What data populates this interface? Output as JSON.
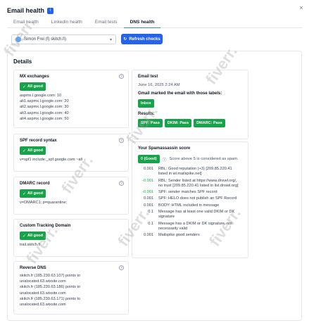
{
  "header": {
    "title": "Email health",
    "close_label": "×"
  },
  "tabs": [
    {
      "label": "Email health",
      "active": false
    },
    {
      "label": "LinkedIn health",
      "active": false
    },
    {
      "label": "Email tests",
      "active": false
    },
    {
      "label": "DNS health",
      "active": true
    }
  ],
  "account_select": {
    "value": "Simon Frei (f) skitch.fi)",
    "chevron": "chevron-down-icon"
  },
  "refresh_button": {
    "label": "Refresh checks",
    "icon": "refresh-icon"
  },
  "details_title": "Details",
  "left": {
    "mx": {
      "title": "MX exchanges",
      "status": "All good",
      "lines": [
        "aspmx.l.google.com: 10",
        "alt1.aspmx.l.google.com: 20",
        "alt2.aspmx.l.google.com: 30",
        "alt3.aspmx.l.google.com: 40",
        "alt4.aspmx.l.google.com: 50"
      ]
    },
    "spf": {
      "title": "SPF record syntax",
      "status": "All good",
      "lines": [
        "v=spf1 include:_spf.google.com ~all"
      ]
    },
    "dmarc": {
      "title": "DMARC record",
      "status": "All good",
      "lines": [
        "v=DMARC1; p=quarantine;"
      ]
    },
    "tracking": {
      "title": "Custom Tracking Domain",
      "status": "All good",
      "lines": [
        "trail.skitch.fi"
      ]
    },
    "rdns": {
      "title": "Reverse DNS",
      "lines": [
        "skitch.fr (185.230.63.107) points to",
        "unalocated.63.wixsite.com",
        "skitch.fr (185.230.63.186) points to",
        "unalocated.63.wixsite.com",
        "skitch.fr (185.230.63.171) points to",
        "unalocated.63.wixsite.com"
      ]
    }
  },
  "right": {
    "email_test": {
      "title": "Email test",
      "date": "June 16, 2025 2:24 AM",
      "marked_label": "Gmail marked the email with those labels:",
      "label_pill": "Inbox",
      "results_label": "Results:",
      "results": [
        "SPF: Pass",
        "DKIM: Pass",
        "DMARC: Pass"
      ]
    },
    "spam": {
      "title": "Your Spamassassin score",
      "score_pill": "0 (Good)",
      "score_note": "Score above 5 is considered as spam.",
      "rows": [
        {
          "score": "0.001",
          "text": "RBL: Good reputation (+3) [209.85.220.41 listed in wl.mailspike.net]",
          "positive": false
        },
        {
          "score": "-0.001",
          "text": "RBL: Sender listed at https://www.dnswl.org/, no trust [209.85.220.41 listed in list.dnswl.org]",
          "positive": true
        },
        {
          "score": "-0.001",
          "text": "SPF: sender matches SPF record",
          "positive": true
        },
        {
          "score": "0.001",
          "text": "SPF: HELO does not publish an SPF Record",
          "positive": false
        },
        {
          "score": "0.001",
          "text": "BODY: HTML included in message",
          "positive": false
        },
        {
          "score": "0.1",
          "text": "Message has at least one valid DKIM or DK signature",
          "positive": false
        },
        {
          "score": "0.1",
          "text": "Message has a DKIM or DK signature, not necessarily valid",
          "positive": false
        },
        {
          "score": "0.001",
          "text": "Mailspike good senders",
          "positive": false
        }
      ]
    }
  },
  "watermark": {
    "text": "fiverr."
  },
  "colors": {
    "accent": "#2563eb",
    "good": "#16a34a"
  }
}
